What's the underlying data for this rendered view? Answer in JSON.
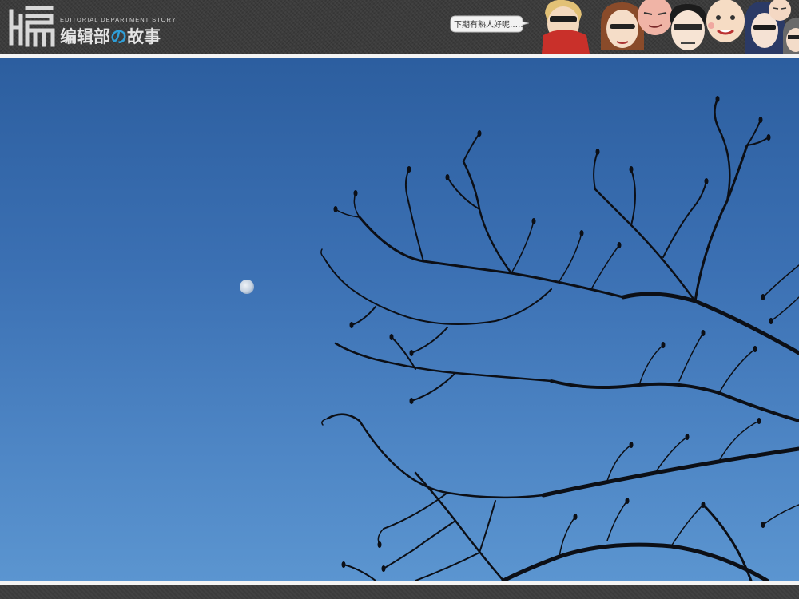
{
  "header": {
    "logo_glyph": "编",
    "logo_subtitle": "EDITORIAL DEPARTMENT STORY",
    "logo_title_a": "编辑部",
    "logo_title_no": "の",
    "logo_title_b": "故事",
    "speech_bubble": "下期有熟人好呢……",
    "accent_color": "#2f9fd8"
  },
  "photo": {
    "subject": "tree-branches-and-moon",
    "sky_color_top": "#2c5e9f",
    "sky_color_bottom": "#5b95d0"
  }
}
